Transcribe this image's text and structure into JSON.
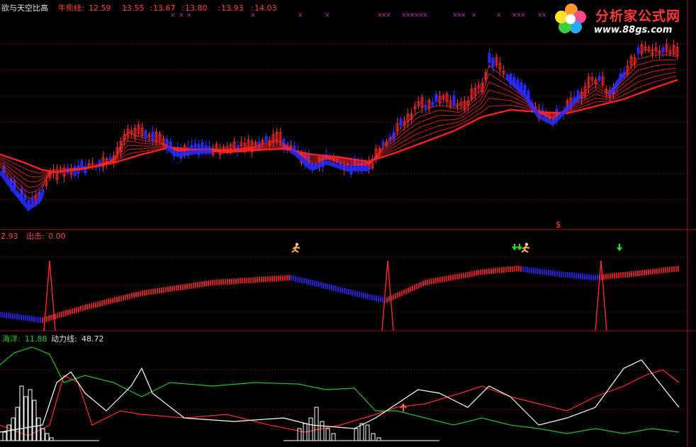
{
  "colors": {
    "up": "#ff2a2a",
    "down": "#2a2aff",
    "ma": "#ff2020",
    "grid": "#8b1a1a",
    "frame": "#a01010",
    "green_line": "#20c020",
    "white_line": "#ffffff",
    "magenta": "#c030c0"
  },
  "top_panel": {
    "indicator_name": "欲与天空比高",
    "line_label": "牛熊线:",
    "values": [
      "12.59",
      "13.55",
      "13.67",
      "13.80",
      "13.93",
      "14.03"
    ],
    "signal_marker": "$"
  },
  "mid_panel": {
    "value": "2.93",
    "exit_label": "出击:",
    "exit_value": "0.00"
  },
  "bottom_panel": {
    "ocean_label": "海洋:",
    "ocean_value": "11.88",
    "power_label": "动力线:",
    "power_value": "48.72"
  },
  "logo": {
    "title": "分析家公式网",
    "url": "www.88gs.com",
    "icon": "flower-logo-icon"
  },
  "icons": [
    "runner-icon",
    "down-arrow-icon",
    "up-arrow-icon"
  ]
}
